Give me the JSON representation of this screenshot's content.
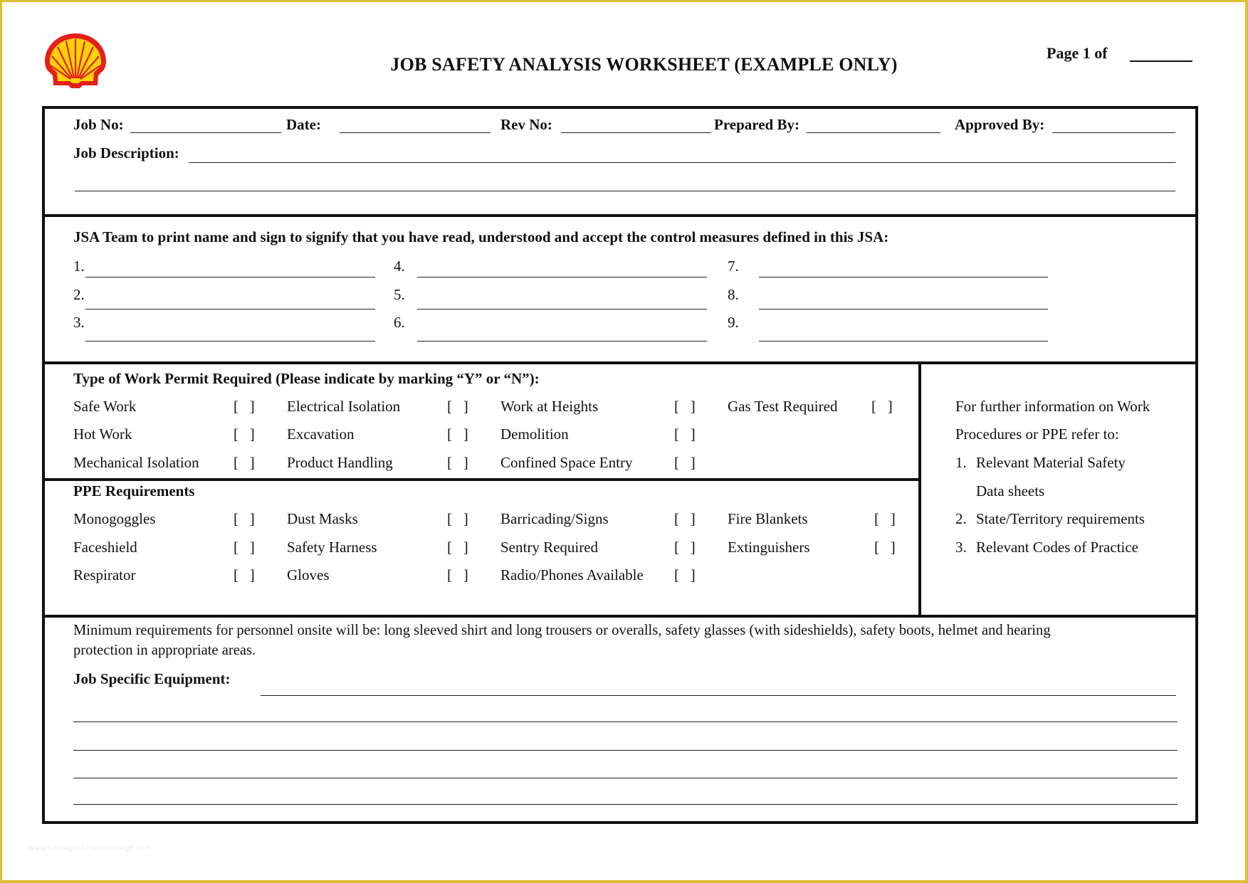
{
  "brand": {
    "logo": "shell-logo-icon",
    "colors": {
      "red": "#e3201b",
      "yellow": "#fbd20a",
      "frame": "#dcc034"
    }
  },
  "header": {
    "title": "JOB SAFETY ANALYSIS WORKSHEET (EXAMPLE ONLY)",
    "page_label": "Page 1 of",
    "page_total": ""
  },
  "job_info": {
    "job_no_label": "Job No:",
    "date_label": "Date:",
    "rev_no_label": "Rev No:",
    "prepared_by_label": "Prepared By:",
    "approved_by_label": "Approved By:",
    "job_description_label": "Job Description:",
    "job_no": "",
    "date": "",
    "rev_no": "",
    "prepared_by": "",
    "approved_by": "",
    "job_description": ""
  },
  "team": {
    "instruction": "JSA Team to print name and sign to signify that you have read, understood and accept the control measures defined in this JSA:",
    "members": [
      {
        "num": "1.",
        "name": ""
      },
      {
        "num": "2.",
        "name": ""
      },
      {
        "num": "3.",
        "name": ""
      },
      {
        "num": "4.",
        "name": ""
      },
      {
        "num": "5.",
        "name": ""
      },
      {
        "num": "6.",
        "name": ""
      },
      {
        "num": "7.",
        "name": ""
      },
      {
        "num": "8.",
        "name": ""
      },
      {
        "num": "9.",
        "name": ""
      }
    ]
  },
  "permits": {
    "heading": "Type of Work Permit Required  (Please indicate by marking “Y” or “N”):",
    "checkbox_mark": "[   ]",
    "items": [
      {
        "label": "Safe Work",
        "value": ""
      },
      {
        "label": "Hot Work",
        "value": ""
      },
      {
        "label": "Mechanical Isolation",
        "value": ""
      },
      {
        "label": "Electrical Isolation",
        "value": ""
      },
      {
        "label": "Excavation",
        "value": ""
      },
      {
        "label": "Product Handling",
        "value": ""
      },
      {
        "label": "Work at Heights",
        "value": ""
      },
      {
        "label": "Demolition",
        "value": ""
      },
      {
        "label": "Confined Space Entry",
        "value": ""
      },
      {
        "label": "Gas Test Required",
        "value": ""
      }
    ]
  },
  "ppe": {
    "heading": "PPE Requirements",
    "items": [
      {
        "label": "Monogoggles",
        "value": ""
      },
      {
        "label": "Faceshield",
        "value": ""
      },
      {
        "label": "Respirator",
        "value": ""
      },
      {
        "label": "Dust Masks",
        "value": ""
      },
      {
        "label": "Safety Harness",
        "value": ""
      },
      {
        "label": "Gloves",
        "value": ""
      },
      {
        "label": "Barricading/Signs",
        "value": ""
      },
      {
        "label": "Sentry Required",
        "value": ""
      },
      {
        "label": "Radio/Phones Available",
        "value": ""
      },
      {
        "label": "Fire Blankets",
        "value": ""
      },
      {
        "label": "Extinguishers",
        "value": ""
      }
    ]
  },
  "info_box": {
    "intro_line1": "For further information on Work",
    "intro_line2": "Procedures or PPE refer to:",
    "refs": [
      {
        "num": "1.",
        "line1": "Relevant Material Safety",
        "line2": "Data sheets"
      },
      {
        "num": "2.",
        "line1": "State/Territory requirements"
      },
      {
        "num": "3.",
        "line1": "Relevant Codes of Practice"
      }
    ]
  },
  "requirements": {
    "line1": "Minimum requirements for personnel onsite will be:  long sleeved shirt and long trousers or overalls, safety glasses (with sideshields), safety boots, helmet and hearing",
    "line2": "protection in appropriate areas.",
    "equipment_label": "Job Specific Equipment:",
    "equipment_lines": [
      "",
      "",
      "",
      "",
      ""
    ]
  },
  "watermark": "www.heritagechristiancollege.com"
}
